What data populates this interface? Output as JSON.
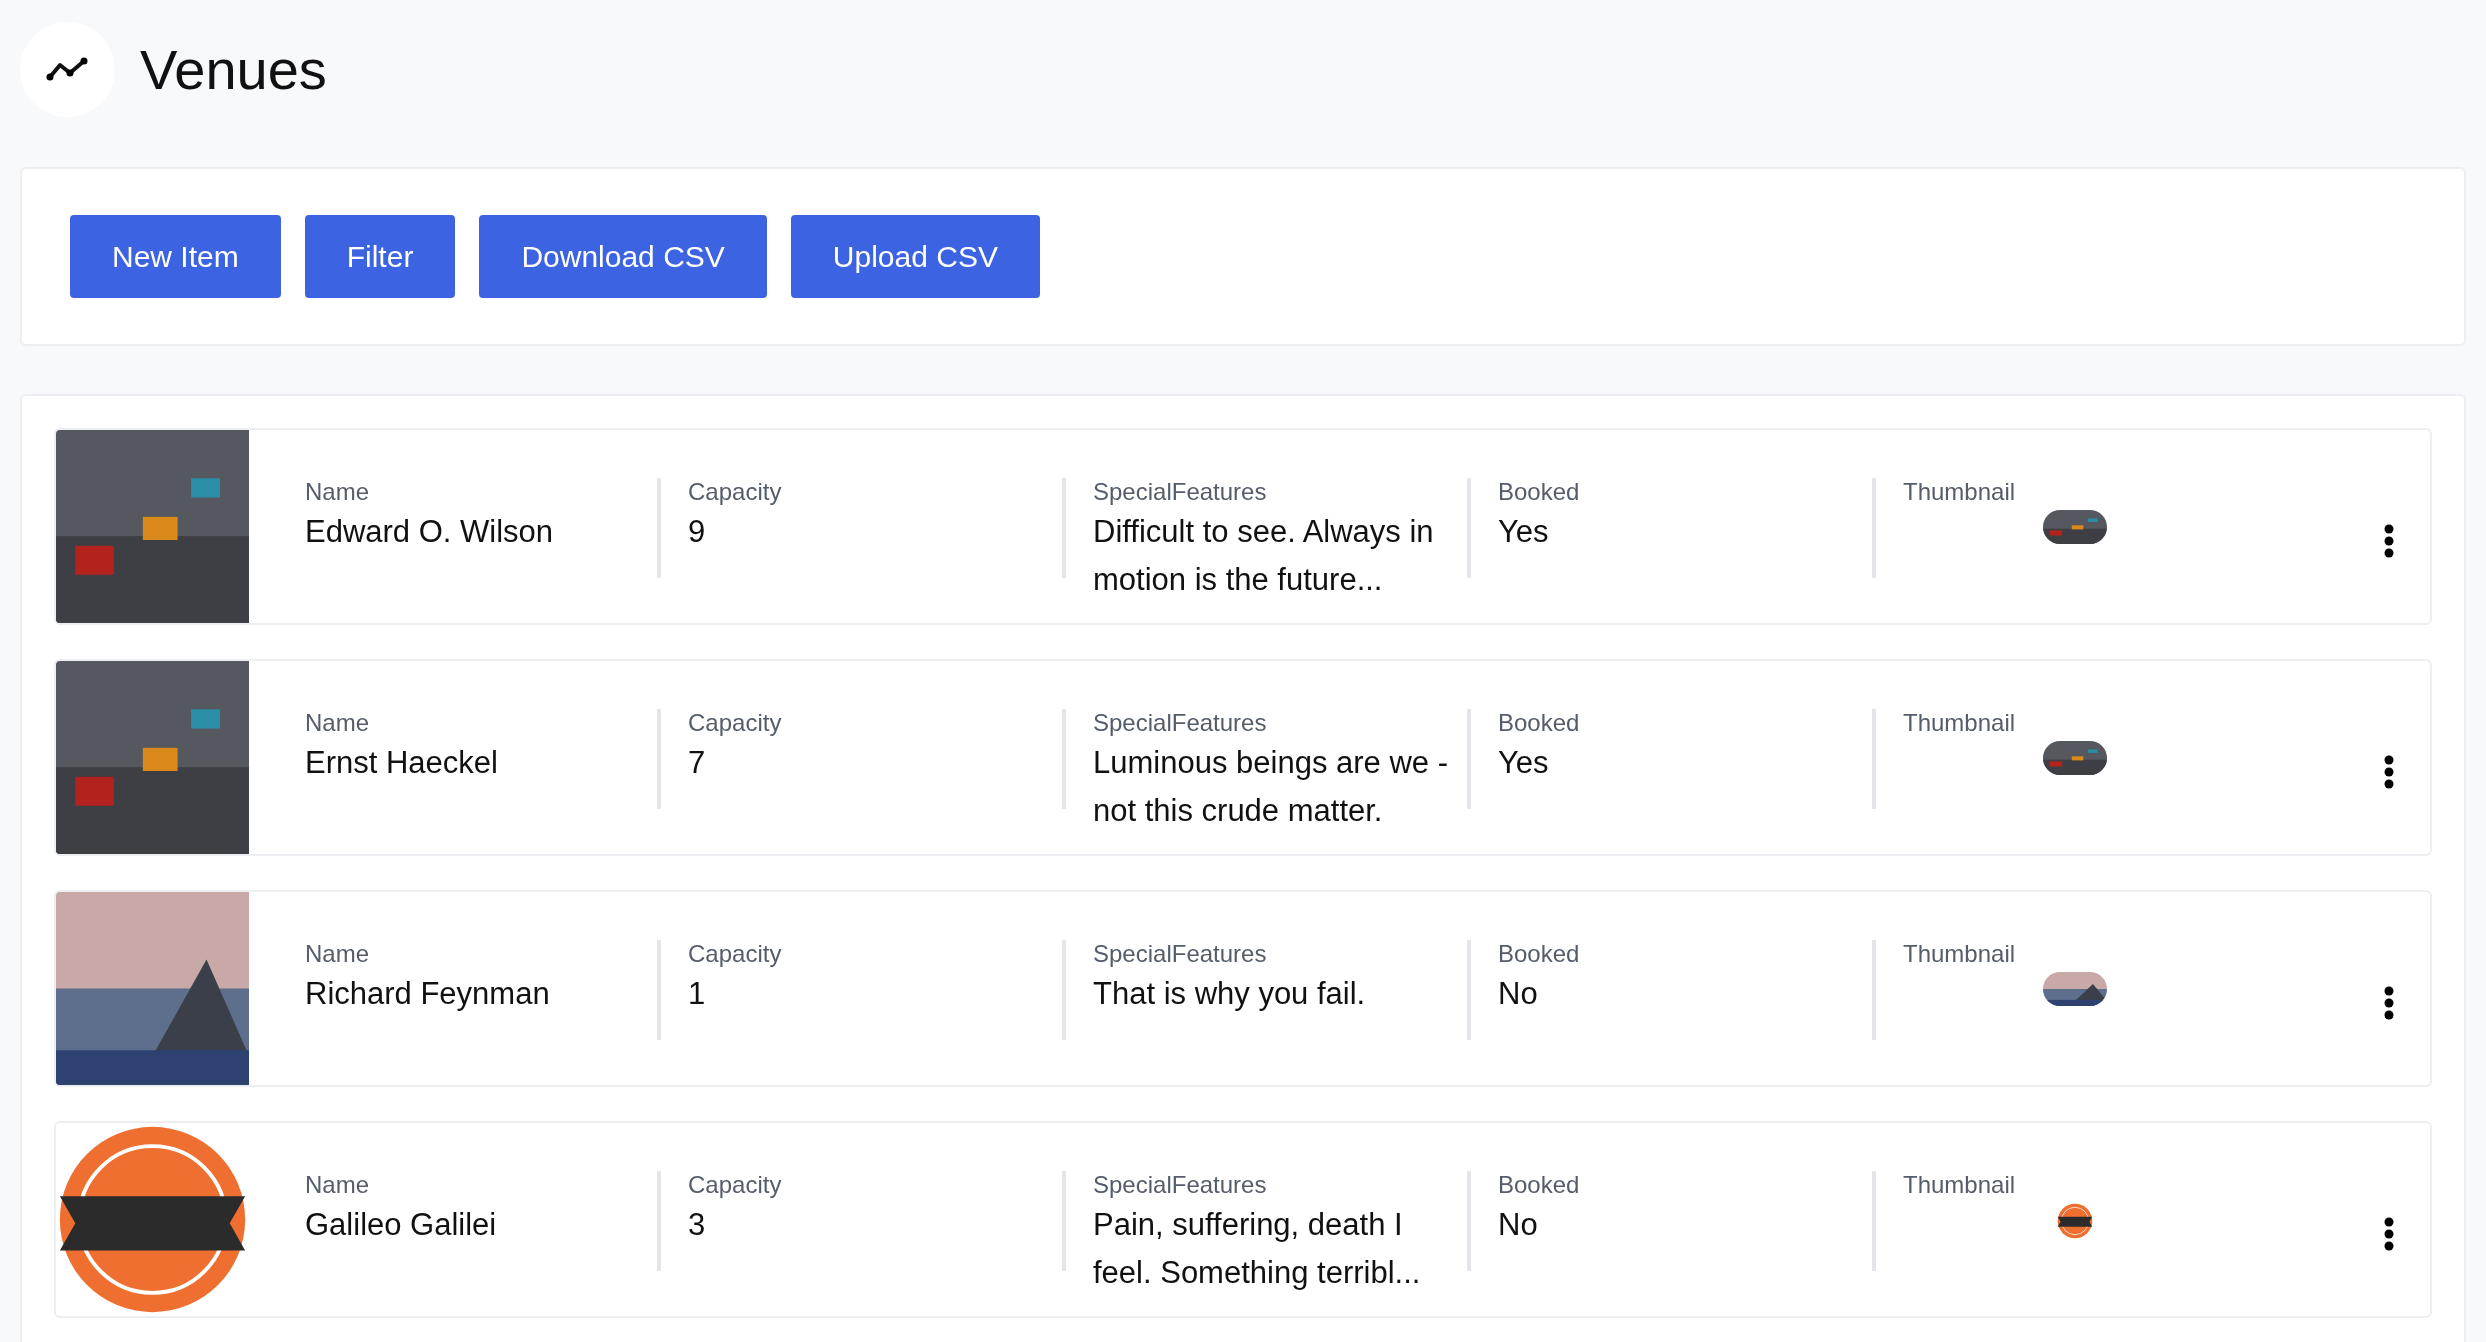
{
  "title": "Venues",
  "toolbar": {
    "buttons": [
      "New Item",
      "Filter",
      "Download CSV",
      "Upload CSV"
    ]
  },
  "venues": [
    {
      "kind": "race",
      "fields": [
        {
          "label": "Name",
          "value": "Edward O. Wilson"
        },
        {
          "label": "Capacity",
          "value": "9"
        },
        {
          "label": "SpecialFeatures",
          "value": "Difficult to see. Always in motion is the future..."
        },
        {
          "label": "Booked",
          "value": "Yes"
        }
      ],
      "thumbnail_label": "Thumbnail"
    },
    {
      "kind": "race",
      "fields": [
        {
          "label": "Name",
          "value": "Ernst Haeckel"
        },
        {
          "label": "Capacity",
          "value": "7"
        },
        {
          "label": "SpecialFeatures",
          "value": "Luminous beings are we - not this crude matter."
        },
        {
          "label": "Booked",
          "value": "Yes"
        }
      ],
      "thumbnail_label": "Thumbnail"
    },
    {
      "kind": "mountain",
      "fields": [
        {
          "label": "Name",
          "value": "Richard Feynman"
        },
        {
          "label": "Capacity",
          "value": "1"
        },
        {
          "label": "SpecialFeatures",
          "value": "That is why you fail."
        },
        {
          "label": "Booked",
          "value": "No"
        }
      ],
      "thumbnail_label": "Thumbnail"
    },
    {
      "kind": "logo",
      "fields": [
        {
          "label": "Name",
          "value": "Galileo Galilei"
        },
        {
          "label": "Capacity",
          "value": "3"
        },
        {
          "label": "SpecialFeatures",
          "value": "Pain, suffering, death I feel. Something terribl..."
        },
        {
          "label": "Booked",
          "value": "No"
        }
      ],
      "thumbnail_label": "Thumbnail"
    }
  ]
}
